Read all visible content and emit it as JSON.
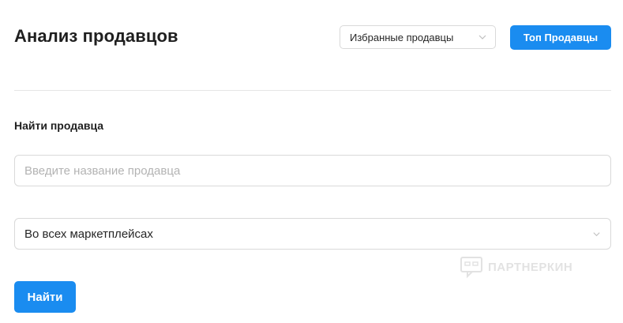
{
  "header": {
    "title": "Анализ продавцов",
    "favorites_select": {
      "value": "Избранные продавцы",
      "icon": "chevron-down-icon"
    },
    "top_button_label": "Топ Продавцы"
  },
  "search": {
    "section_label": "Найти продавца",
    "input_value": "",
    "input_placeholder": "Введите название продавца",
    "marketplace_select": {
      "value": "Во всех маркетплейсах",
      "icon": "chevron-down-icon"
    },
    "submit_label": "Найти"
  },
  "watermark": {
    "text": "ПАРТНЕРКИН",
    "icon": "partnerkin-logo-icon"
  },
  "colors": {
    "accent": "#1a8cf0",
    "border": "#d9d9d9",
    "divider": "#e5e5e5",
    "placeholder": "#b3b3b3"
  }
}
